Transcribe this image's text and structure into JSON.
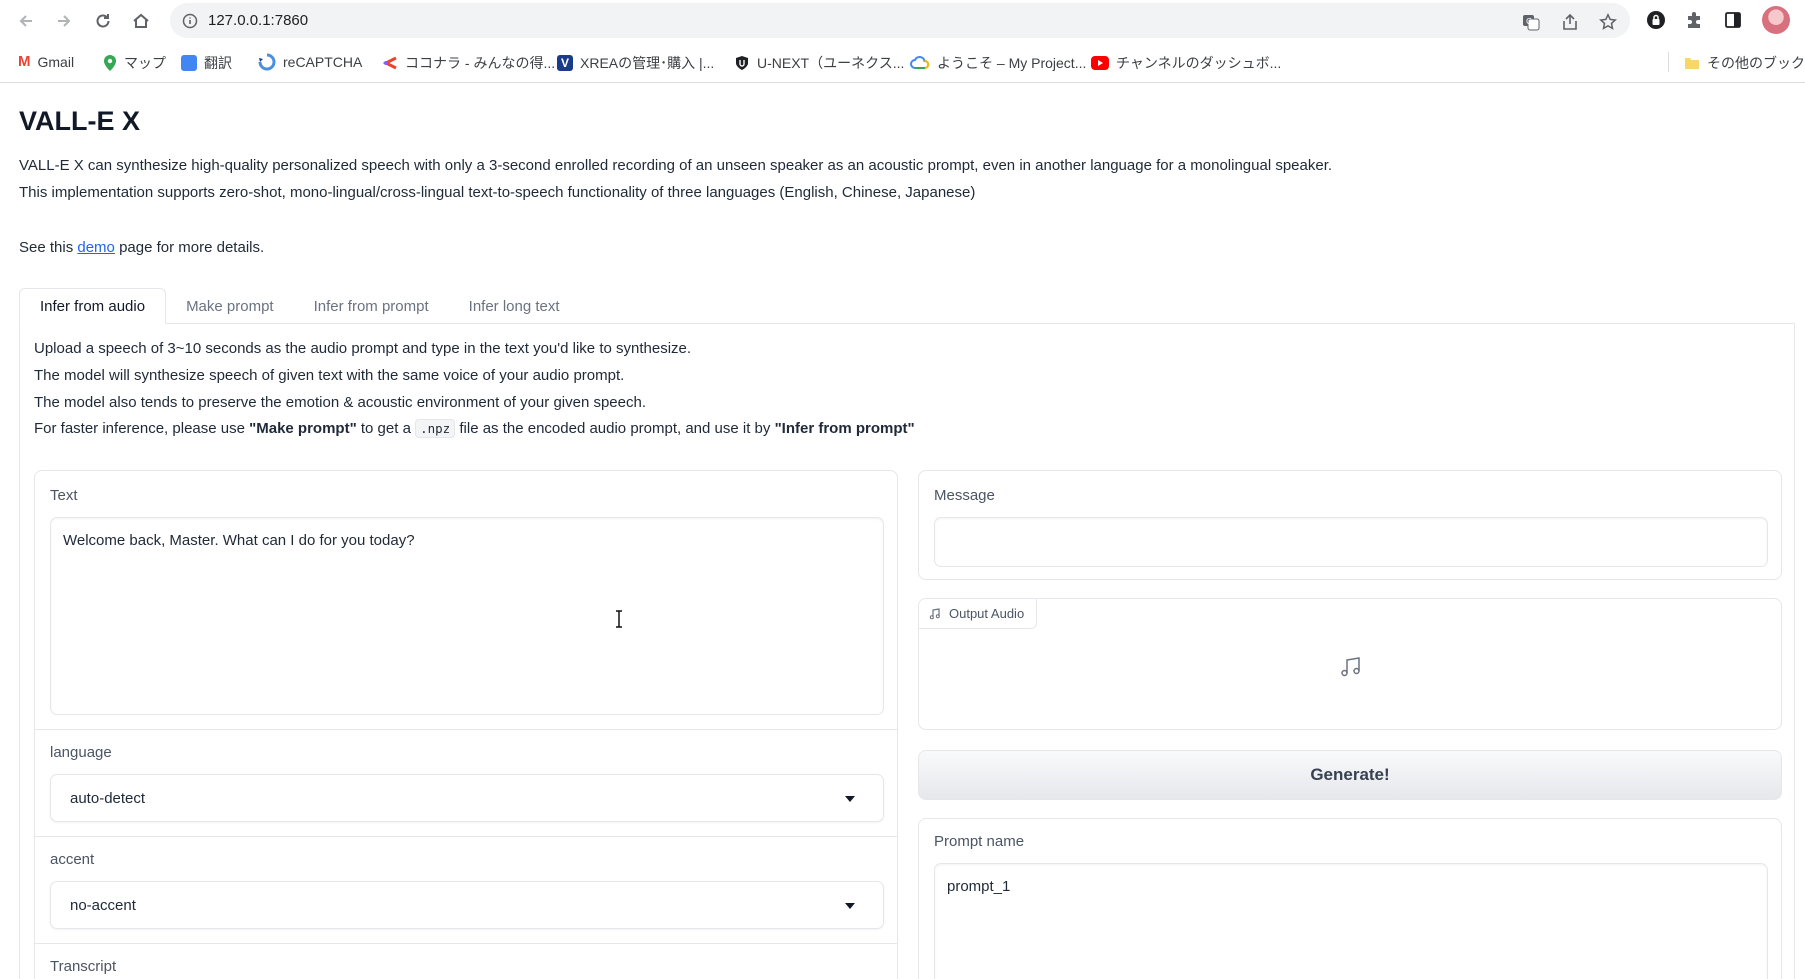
{
  "browser": {
    "url": "127.0.0.1:7860",
    "bookmarks": [
      {
        "label": "Gmail",
        "color": "#ea4335"
      },
      {
        "label": "マップ",
        "color": "#34a853"
      },
      {
        "label": "翻訳",
        "color": "#4285f4"
      },
      {
        "label": "reCAPTCHA",
        "color": "#4a90e2"
      },
      {
        "label": "ココナラ - みんなの得...",
        "color": "#e8452c"
      },
      {
        "label": "XREAの管理･購入 |...",
        "color": "#1a3a8a"
      },
      {
        "label": "U-NEXT（ユーネクス...",
        "color": "#202124"
      },
      {
        "label": "ようこそ – My Project...",
        "color": "#fbbc04"
      },
      {
        "label": "チャンネルのダッシュボ...",
        "color": "#ff0000"
      }
    ],
    "other_bookmarks": "その他のブックマー"
  },
  "page": {
    "title": "VALL-E X",
    "desc_line1": "VALL-E X can synthesize high-quality personalized speech with only a 3-second enrolled recording of an unseen speaker as an acoustic prompt, even in another language for a monolingual speaker.",
    "desc_line2": "This implementation supports zero-shot, mono-lingual/cross-lingual text-to-speech functionality of three languages (English, Chinese, Japanese)",
    "see_prefix": "See this ",
    "see_link": "demo",
    "see_suffix": " page for more details."
  },
  "tabs": [
    "Infer from audio",
    "Make prompt",
    "Infer from prompt",
    "Infer long text"
  ],
  "instructions": {
    "line1": "Upload a speech of 3~10 seconds as the audio prompt and type in the text you'd like to synthesize.",
    "line2": "The model will synthesize speech of given text with the same voice of your audio prompt.",
    "line3": "The model also tends to preserve the emotion & acoustic environment of your given speech.",
    "line4_a": "For faster inference, please use ",
    "line4_b": "\"Make prompt\"",
    "line4_c": " to get a ",
    "line4_code": ".npz",
    "line4_d": " file as the encoded audio prompt, and use it by ",
    "line4_e": "\"Infer from prompt\""
  },
  "form": {
    "text_label": "Text",
    "text_value": "Welcome back, Master. What can I do for you today?",
    "language_label": "language",
    "language_value": "auto-detect",
    "accent_label": "accent",
    "accent_value": "no-accent",
    "transcript_label": "Transcript"
  },
  "output": {
    "message_label": "Message",
    "message_value": "",
    "audio_label": "Output Audio",
    "generate_label": "Generate!",
    "prompt_name_label": "Prompt name",
    "prompt_name_value": "prompt_1"
  }
}
